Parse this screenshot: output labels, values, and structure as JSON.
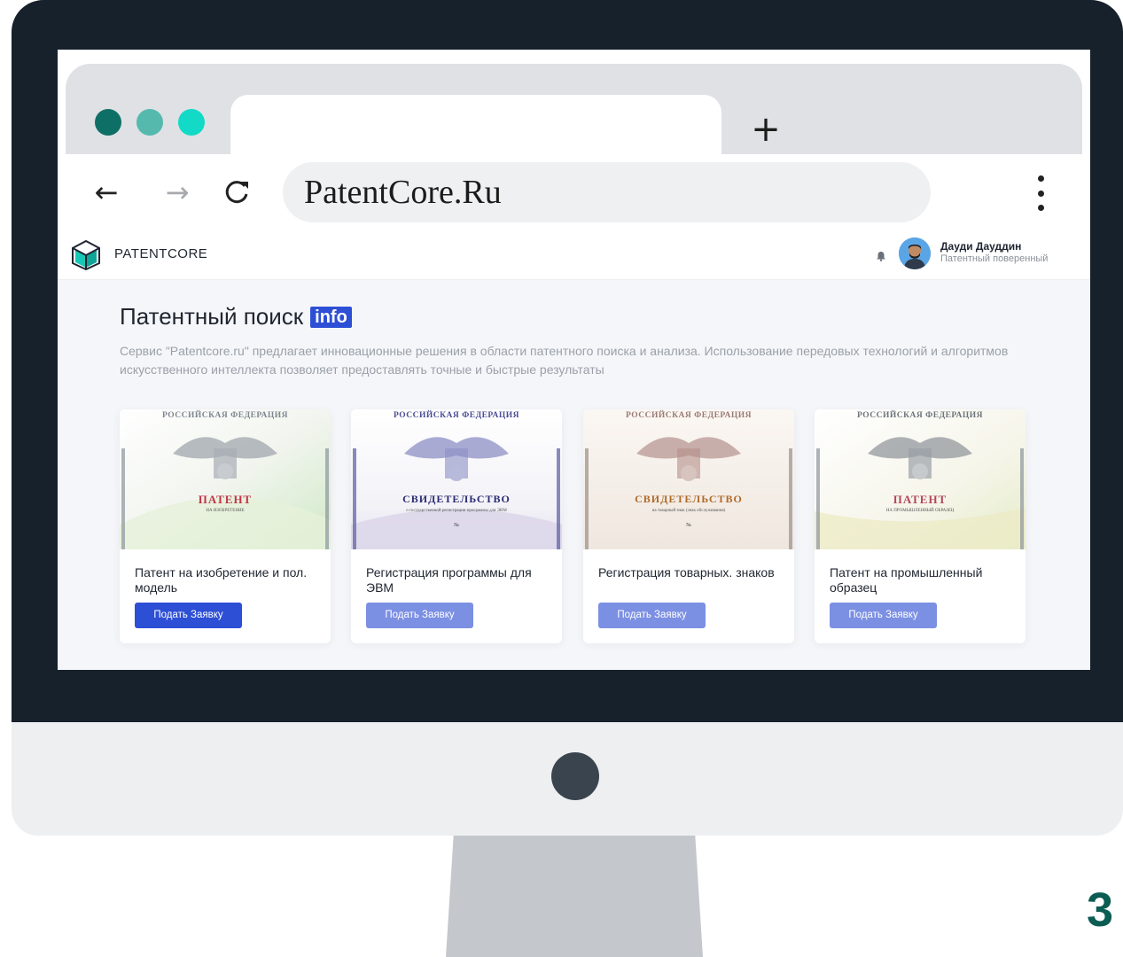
{
  "browser": {
    "new_tab_label": "+",
    "address": "PatentCore.Ru",
    "nav_icons": [
      "arrow-left-icon",
      "arrow-right-icon",
      "reload-icon",
      "kebab-menu-icon"
    ]
  },
  "header": {
    "logo_text": "PATENTCORE",
    "user_name": "Дауди Даудд​ин",
    "user_role": "Патентный поверенный"
  },
  "main": {
    "title": "Патентный поиск",
    "badge": "info",
    "description": "Сервис \"Patentcore.ru\" предлагает инновационные решения в области патентного поиска и анализа. Использование передовых технологий и алгоритмов искусственного интеллекта позволяет предоставлять точные и быстрые результаты"
  },
  "cards": [
    {
      "title": "Патент на изобретение и пол. модель",
      "button": "Подать Заявку",
      "cert_header": "РОССИЙСКАЯ ФЕДЕРАЦИЯ",
      "cert_title": "ПАТЕНТ",
      "cert_subtitle": "НА ИЗОБРЕТЕНИЕ",
      "cert_number": ""
    },
    {
      "title": "Регистрация программы для ЭВМ",
      "button": "Подать Заявку",
      "cert_header": "РОССИЙСКАЯ ФЕДЕРАЦИЯ",
      "cert_title": "СВИДЕТЕЛЬСТВО",
      "cert_subtitle": "о государственной регистрации программы для ЭВМ",
      "cert_number": "№"
    },
    {
      "title": "Регистрация товарных. знаков",
      "button": "Подать Заявку",
      "cert_header": "РОССИЙСКАЯ ФЕДЕРАЦИЯ",
      "cert_title": "СВИДЕТЕЛЬСТВО",
      "cert_subtitle": "на товарный знак (знак обслуживания)",
      "cert_number": "№"
    },
    {
      "title": "Патент на промышленный образец",
      "button": "Подать Заявку",
      "cert_header": "РОССИЙСКАЯ ФЕДЕРАЦИЯ",
      "cert_title": "ПАТЕНТ",
      "cert_subtitle": "НА ПРОМЫШЛЕННЫЙ ОБРАЗЕЦ",
      "cert_number": ""
    }
  ],
  "slide_number": "3",
  "colors": {
    "accent": "#2d4fd6",
    "accent_light": "#7b8fe3",
    "monitor_bezel": "#17212b",
    "window_dot_1": "#0e6f66",
    "window_dot_2": "#55b9ae",
    "window_dot_3": "#12dac6",
    "slide_number": "#0b5c53"
  }
}
